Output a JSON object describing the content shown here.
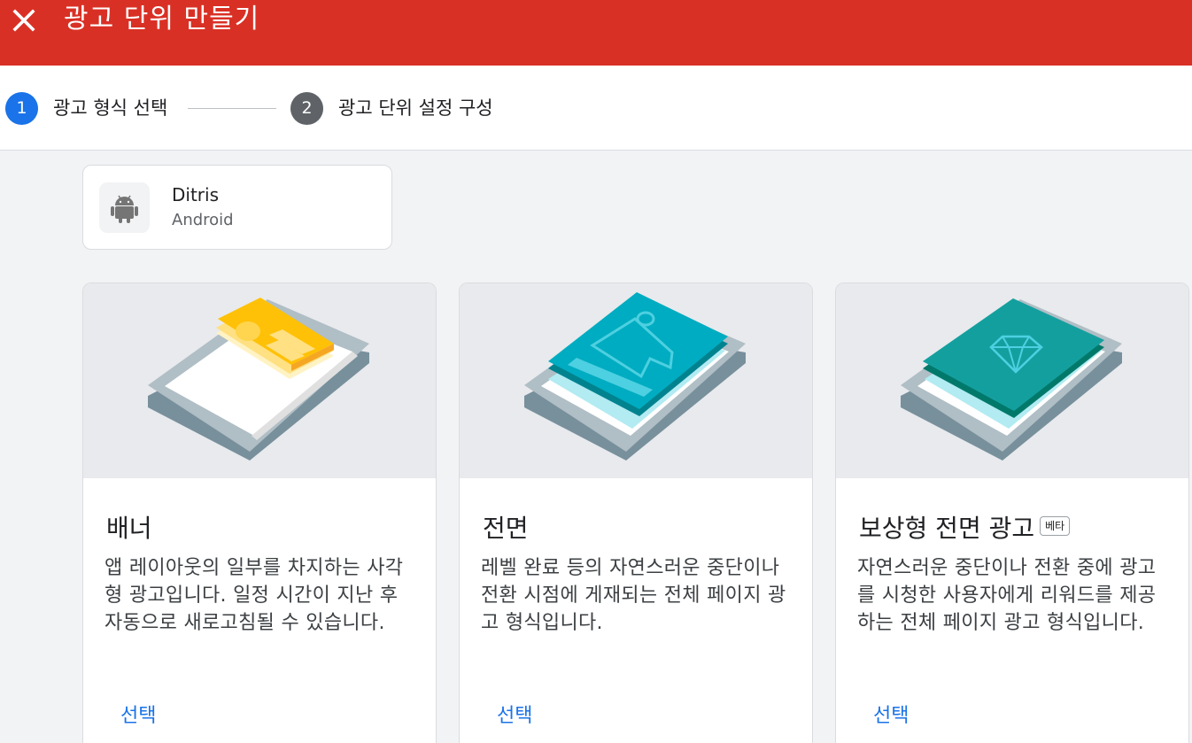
{
  "header": {
    "title": "광고 단위 만들기",
    "close_icon": "close-icon",
    "color": "#d93025"
  },
  "stepper": {
    "steps": [
      {
        "number": "1",
        "label": "광고 형식 선택",
        "state": "active",
        "color": "#1a73e8"
      },
      {
        "number": "2",
        "label": "광고 단위 설정 구성",
        "state": "inactive",
        "color": "#5f6368"
      }
    ]
  },
  "app": {
    "name": "Ditris",
    "platform": "Android",
    "icon": "android-icon"
  },
  "formats": [
    {
      "title": "배너",
      "description": "앱 레이아웃의 일부를 차지하는 사각형 광고입니다. 일정 시간이 지난 후 자동으로 새로고침될 수 있습니다.",
      "action": "선택",
      "badge": ""
    },
    {
      "title": "전면",
      "description": "레벨 완료 등의 자연스러운 중단이나 전환 시점에 게재되는 전체 페이지 광고 형식입니다.",
      "action": "선택",
      "badge": ""
    },
    {
      "title": "보상형 전면 광고",
      "description": "자연스러운 중단이나 전환 중에 광고를 시청한 사용자에게 리워드를 제공하는 전체 페이지 광고 형식입니다.",
      "action": "선택",
      "badge": "베타"
    }
  ]
}
